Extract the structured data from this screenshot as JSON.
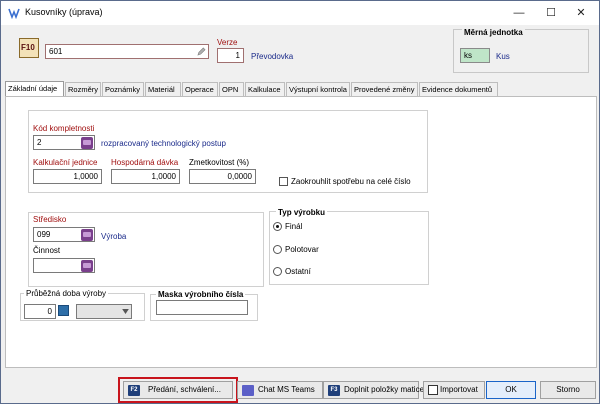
{
  "window": {
    "title": "Kusovníky (úprava)",
    "controls": [
      "—",
      "☐",
      "✕"
    ]
  },
  "header": {
    "logo_text": "F10",
    "code_value": "601",
    "version_label": "Verze",
    "version_value": "1",
    "version_name": "Převodovka"
  },
  "unit": {
    "title": "Měrná jednotka",
    "code": "ks",
    "name": "Kus"
  },
  "tabs": [
    "Základní údaje",
    "Rozměry",
    "Poznámky",
    "Materiál",
    "Operace",
    "OPN",
    "Kalkulace",
    "Výstupní kontrola",
    "Provedené změny",
    "Evidence dokumentů"
  ],
  "main": {
    "completeness_label": "Kód kompletnosti",
    "completeness_value": "2",
    "completeness_text": "rozpracovaný technologický postup",
    "calc_unit_label": "Kalkulační jednice",
    "calc_unit_value": "1,0000",
    "batch_label": "Hospodárná dávka",
    "batch_value": "1,0000",
    "waste_label": "Zmetkovitost (%)",
    "waste_value": "0,0000",
    "round_label": "Zaokrouhlit spotřebu na celé číslo",
    "center_label": "Středisko",
    "center_value": "099",
    "center_name": "Výroba",
    "activity_label": "Činnost",
    "activity_value": "",
    "product_type_title": "Typ výrobku",
    "product_types": [
      "Finál",
      "Polotovar",
      "Ostatní"
    ],
    "product_type_selected": "Finál",
    "lead_time_title": "Průběžná doba výroby",
    "lead_time_value": "0",
    "lead_time_unit": "",
    "serial_mask_title": "Maska výrobního čísla",
    "serial_mask_value": ""
  },
  "footer": {
    "handover_key": "F2",
    "handover_label": "Předání, schválení...",
    "teams_label": "Chat MS Teams",
    "fill_key": "F3",
    "fill_label": "Doplnit položky matice",
    "import_label": "Importovat",
    "ok_label": "OK",
    "cancel_label": "Storno"
  },
  "colors": {
    "highlight": "#c8141c",
    "required_label": "#a01010",
    "link_text": "#1a2a8a"
  }
}
